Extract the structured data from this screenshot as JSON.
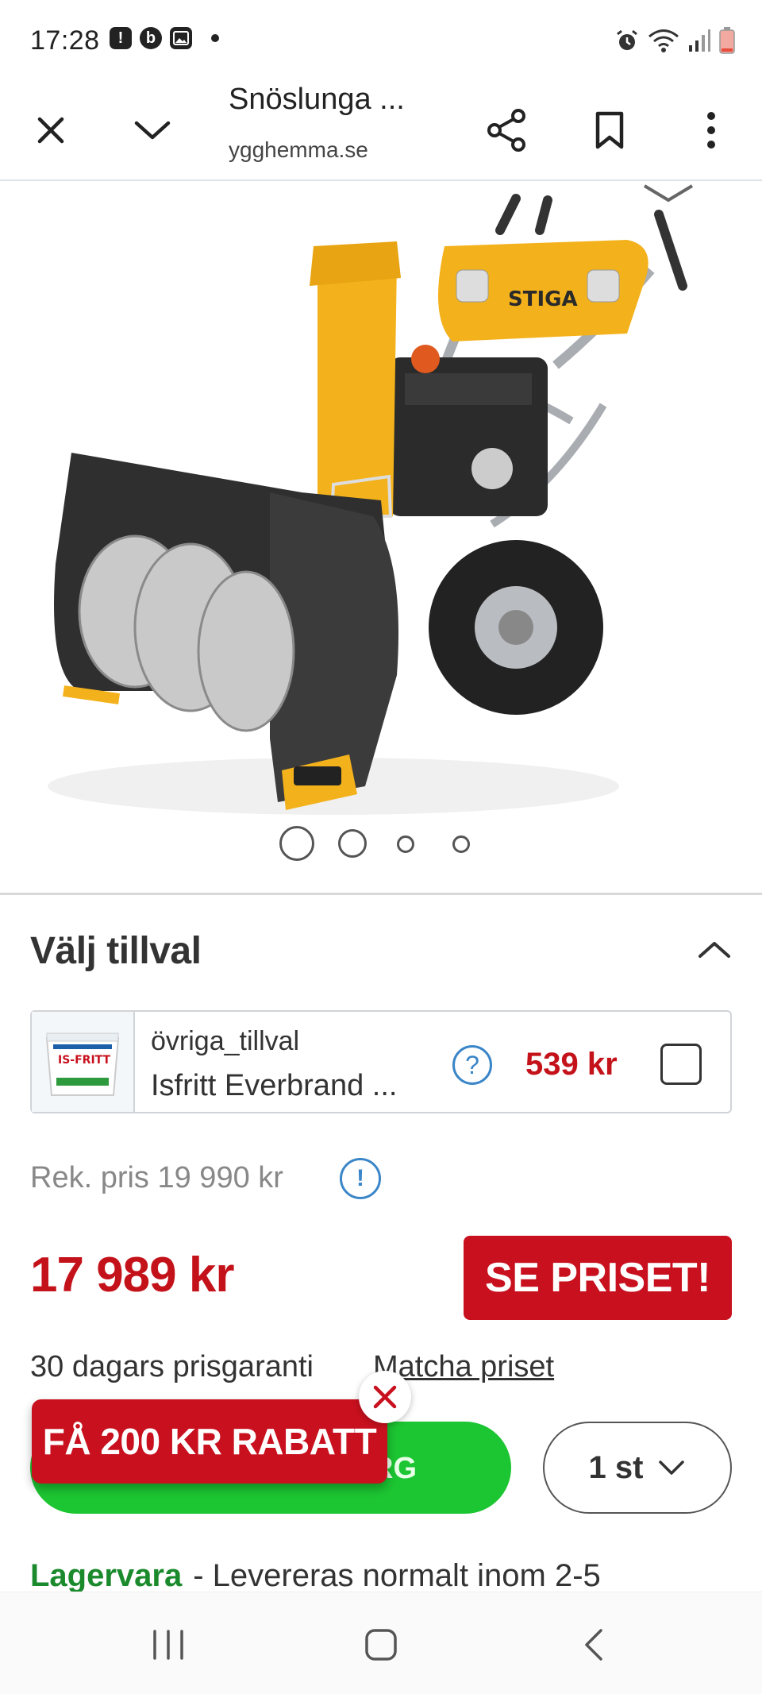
{
  "status_bar": {
    "time": "17:28",
    "notification_icons": [
      "alert-icon",
      "b-app-icon",
      "gallery-icon"
    ],
    "system_icons": [
      "alarm-icon",
      "wifi-icon",
      "signal-icon",
      "battery-icon"
    ]
  },
  "browser": {
    "page_title": "Snöslunga ...",
    "url": "ygghemma.se",
    "buttons": [
      "close-icon",
      "chevron-down-icon",
      "share-icon",
      "bookmark-icon",
      "more-icon"
    ]
  },
  "product": {
    "image_alt": "snow-blower-image",
    "carousel": {
      "count": 4,
      "active": 0
    }
  },
  "options": {
    "title": "Välj tillval",
    "addon": {
      "category": "övriga_tillval",
      "name": "Isfritt Everbrand ...",
      "thumb_label": "IS-FRITT",
      "price": "539 kr",
      "help": "?"
    }
  },
  "pricing": {
    "recommended": "Rek. pris 19 990 kr",
    "info": "!",
    "current": "17 989 kr",
    "see_price_button": "SE PRISET!",
    "guarantee": "30 dagars prisgaranti",
    "match_link": "Matcha priset"
  },
  "cart": {
    "button_label_partial": "RG",
    "quantity": "1 st",
    "promo": "FÅ 200 KR RABATT"
  },
  "stock": {
    "status": "Lagervara",
    "text": "- Levereras normalt inom 2-5"
  },
  "colors": {
    "accent_red": "#c8101e",
    "price_red": "#c4121a",
    "cart_green": "#1cc532",
    "stock_green": "#1a8a2c",
    "link_blue": "#3a86c8",
    "machine_yellow": "#f3b21c"
  }
}
